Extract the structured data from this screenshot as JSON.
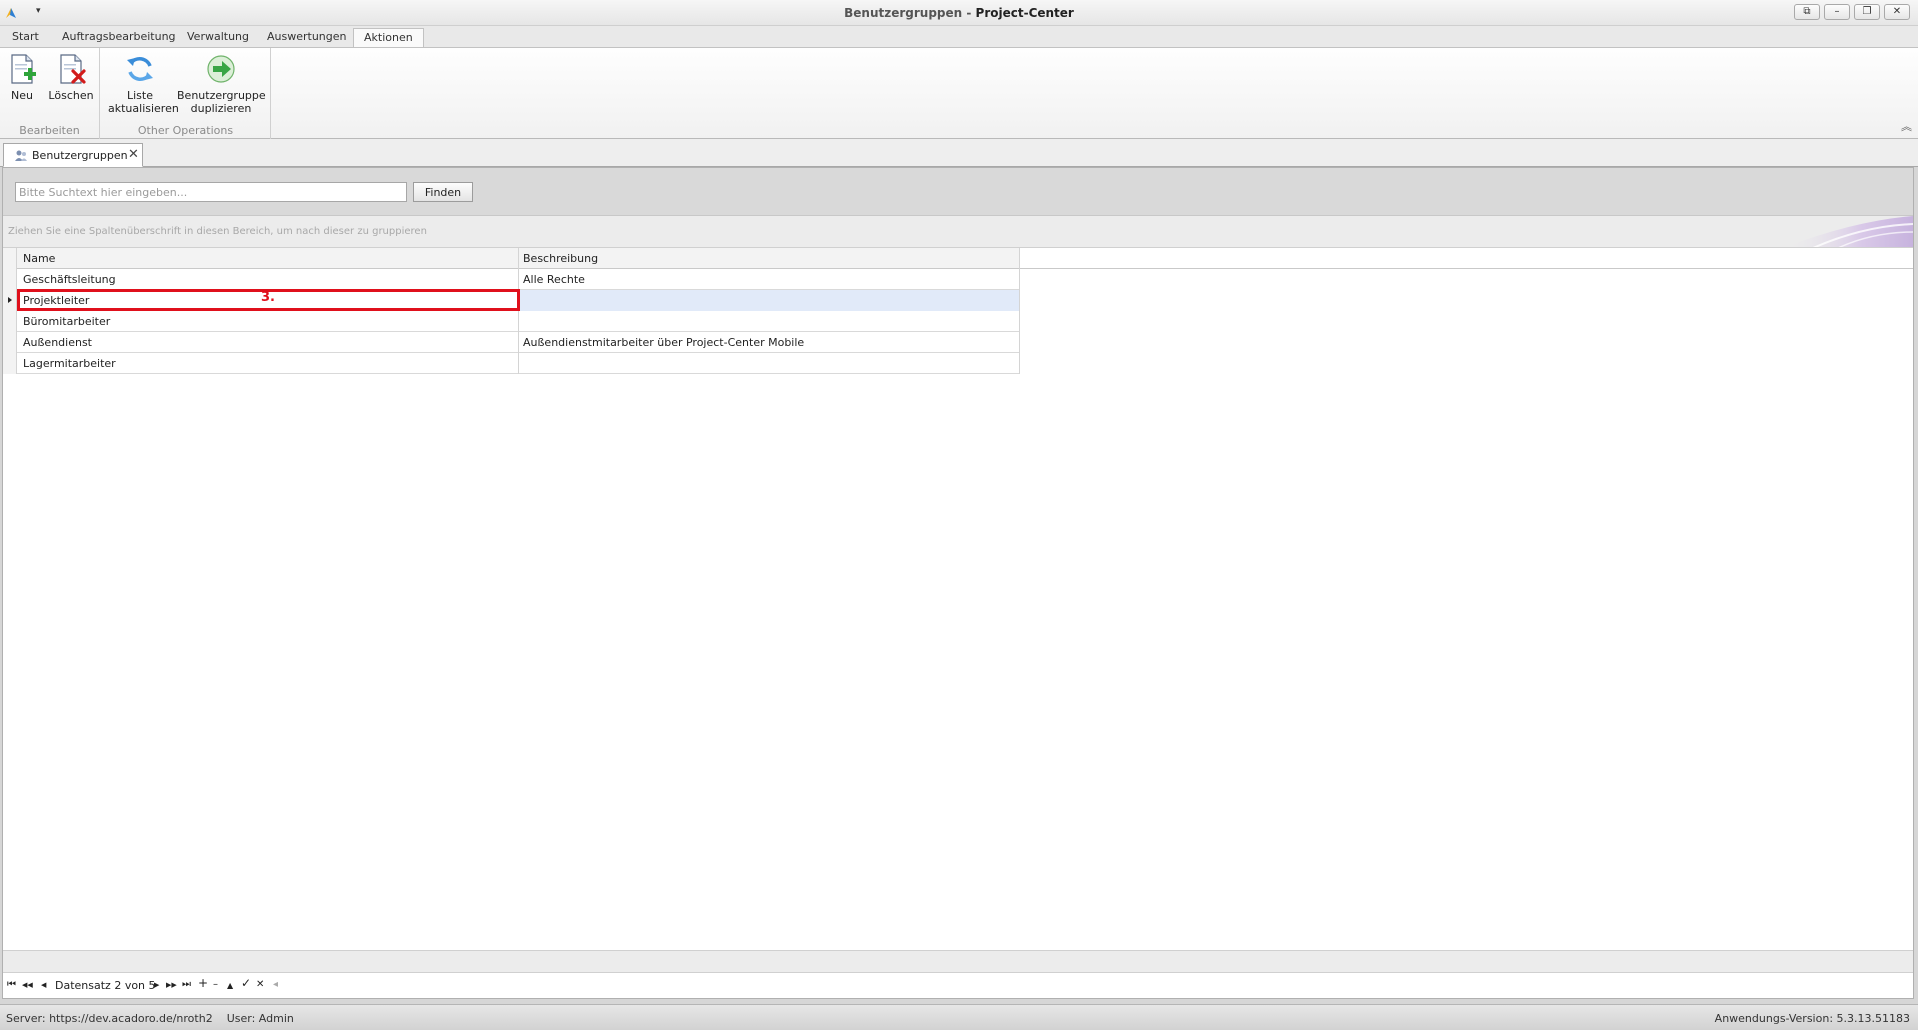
{
  "window": {
    "title_prefix": "Benutzergruppen -",
    "title_app": "Project-Center",
    "dropdown_glyph": "▾",
    "buttons": {
      "monitor": "⧉",
      "minimize": "–",
      "restore": "❐",
      "close": "✕"
    }
  },
  "ribbon": {
    "tabs": [
      {
        "label": "Start"
      },
      {
        "label": "Auftragsbearbeitung"
      },
      {
        "label": "Verwaltung"
      },
      {
        "label": "Auswertungen"
      },
      {
        "label": "Aktionen",
        "active": true
      }
    ],
    "groups": [
      {
        "label": "Bearbeiten",
        "buttons": [
          {
            "label": "Neu",
            "icon": "new-document-icon"
          },
          {
            "label": "Löschen",
            "icon": "delete-document-icon"
          }
        ]
      },
      {
        "label": "Other Operations",
        "buttons": [
          {
            "label_line1": "Liste",
            "label_line2": "aktualisieren",
            "icon": "refresh-icon"
          },
          {
            "label_line1": "Benutzergruppe",
            "label_line2": "duplizieren",
            "icon": "duplicate-icon"
          }
        ]
      }
    ],
    "collapse_glyph": "︽"
  },
  "doc_tab": {
    "label": "Benutzergruppen",
    "icon": "user-group-icon",
    "close_glyph": "✕"
  },
  "search": {
    "placeholder": "Bitte Suchtext hier eingeben...",
    "value": "",
    "button": "Finden"
  },
  "group_panel_hint": "Ziehen Sie eine Spaltenüberschrift in diesen Bereich, um nach dieser zu gruppieren",
  "grid": {
    "columns": [
      "Name",
      "Beschreibung"
    ],
    "rows": [
      {
        "name": "Geschäftsleitung",
        "beschreibung": "Alle Rechte"
      },
      {
        "name": "Projektleiter",
        "beschreibung": ""
      },
      {
        "name": "Büromitarbeiter",
        "beschreibung": ""
      },
      {
        "name": "Außendienst",
        "beschreibung": "Außendienstmitarbeiter über Project-Center Mobile"
      },
      {
        "name": "Lagermitarbeiter",
        "beschreibung": ""
      }
    ],
    "focused_row": 2
  },
  "annotation": {
    "label": "3.",
    "color": "#e0101c"
  },
  "navigator": {
    "text": "Datensatz 2 von 5",
    "glyphs": {
      "first": "⏮",
      "prev_page": "◀◀",
      "prev": "◀",
      "next": "▶",
      "next_page": "▶▶",
      "last": "⏭",
      "append": "+",
      "remove": "–",
      "up": "▲",
      "apply": "✓",
      "cancel": "✕",
      "filter": "◂"
    }
  },
  "status": {
    "server": "Server: https://dev.acadoro.de/nroth2",
    "user": "User: Admin",
    "version": "Anwendungs-Version: 5.3.13.51183"
  }
}
